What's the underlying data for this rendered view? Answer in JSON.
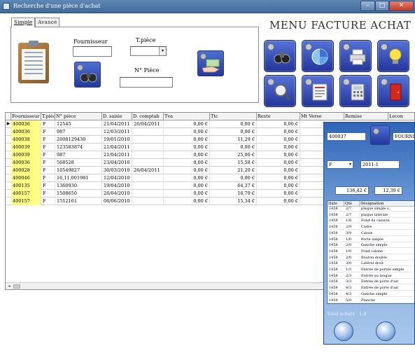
{
  "window": {
    "title": "Recherche d'une pièce d'achat",
    "minimize": "–",
    "maximize": "□",
    "close": "✕"
  },
  "tabs": [
    {
      "label": "Simple"
    },
    {
      "label": "Avancé"
    }
  ],
  "form": {
    "fournisseur_label": "Fournisseur",
    "fournisseur_value": "",
    "type_piece_label": "T.pièce",
    "type_piece_value": "",
    "num_piece_label": "N° Pièce",
    "num_piece_value": ""
  },
  "menu_title": "MENU FACTURE ACHAT",
  "menu_icons": [
    "binoculars-icon",
    "pie-chart-icon",
    "printer-icon",
    "light-bulb-icon",
    "magnifier-icon",
    "document-stack-icon",
    "calculator-icon",
    "exit-door-icon"
  ],
  "table": {
    "headers": [
      "Fournisseur",
      "T.pièce",
      "N° pièce",
      "D. saisie",
      "D. comptab",
      "Tva",
      "Ttc",
      "Reste",
      "Mt Verse",
      "Remise",
      "Lecon"
    ],
    "rows": [
      [
        "400036",
        "F",
        "12545",
        "21/04/2011",
        "26/04/2011",
        "0,00 €",
        "0,00 €",
        "0,00 €"
      ],
      [
        "400036",
        "F",
        "987",
        "12/03/2011",
        "",
        "0,00 €",
        "0,00 €",
        "0,00 €"
      ],
      [
        "400038",
        "F",
        "2008129430",
        "19/01/2010",
        "",
        "0,00 €",
        "11,29 €",
        "0,00 €"
      ],
      [
        "400039",
        "F",
        "123583874",
        "21/04/2011",
        "",
        "0,00 €",
        "0,00 €",
        "0,00 €"
      ],
      [
        "400039",
        "F",
        "987",
        "21/04/2011",
        "",
        "0,00 €",
        "25,00 €",
        "0,00 €"
      ],
      [
        "400036",
        "F",
        "568528",
        "23/04/2010",
        "",
        "0,00 €",
        "15,58 €",
        "0,00 €"
      ],
      [
        "400028",
        "F",
        "10549827",
        "30/03/2010",
        "26/04/2011",
        "0,00 €",
        "21,20 €",
        "0,00 €"
      ],
      [
        "400046",
        "F",
        "16,11,001981",
        "12/04/2010",
        "",
        "0,00 €",
        "0,00 €",
        "0,00 €"
      ],
      [
        "400135",
        "F",
        "1360930",
        "19/04/2010",
        "",
        "0,00 €",
        "64,37 €",
        "0,00 €"
      ],
      [
        "400157",
        "F",
        "1508650",
        "26/04/2010",
        "",
        "0,00 €",
        "16,79 €",
        "0,00 €"
      ],
      [
        "400157",
        "F",
        "1512161",
        "08/06/2010",
        "",
        "0,00 €",
        "15,34 €",
        "0,00 €"
      ]
    ]
  },
  "overlay": {
    "fournisseur_value": "400037",
    "libelle_value": "FOURNIS N",
    "piece_value": "F",
    "numero_value": "2011-1",
    "total_ht_value": "136,42 €",
    "tva_value": "12,39 €",
    "list_headers": [
      "Date",
      "Qté",
      "Désignation"
    ],
    "list_rows": [
      [
        "1458 ",
        "2/7",
        "plaque simple s."
      ],
      [
        "1458 ",
        "2/7",
        "plaque latérale"
      ],
      [
        "1458 ",
        "1/8",
        "Fond de caisson"
      ],
      [
        "1458 ",
        "2/9",
        "Cadre"
      ],
      [
        "1458 ",
        "3/9",
        "Caisse"
      ],
      [
        "1458 ",
        "1/0",
        "Porte simple"
      ],
      [
        "1458 ",
        "2/0",
        "Gauche simple"
      ],
      [
        "1458 ",
        "1/0",
        "Fond cabine"
      ],
      [
        "1458 ",
        "2/0",
        "Bouton double"
      ],
      [
        "1458 ",
        "3/0",
        "Latéral droit"
      ],
      [
        "1458 ",
        "1/3",
        "Entrée de portée simple"
      ],
      [
        "1458 ",
        "2/3",
        "Entrée au langue"
      ],
      [
        "1458 ",
        "3/3",
        "Entrée de porte d'air"
      ],
      [
        "1458 ",
        "4/3",
        "Entrée de porte d'air"
      ],
      [
        "1458 ",
        "4/3",
        "Gauche simple"
      ],
      [
        "1458 ",
        "5/0",
        "Planche"
      ]
    ],
    "footer_label": "Total achats",
    "footer_count": "1,4"
  }
}
